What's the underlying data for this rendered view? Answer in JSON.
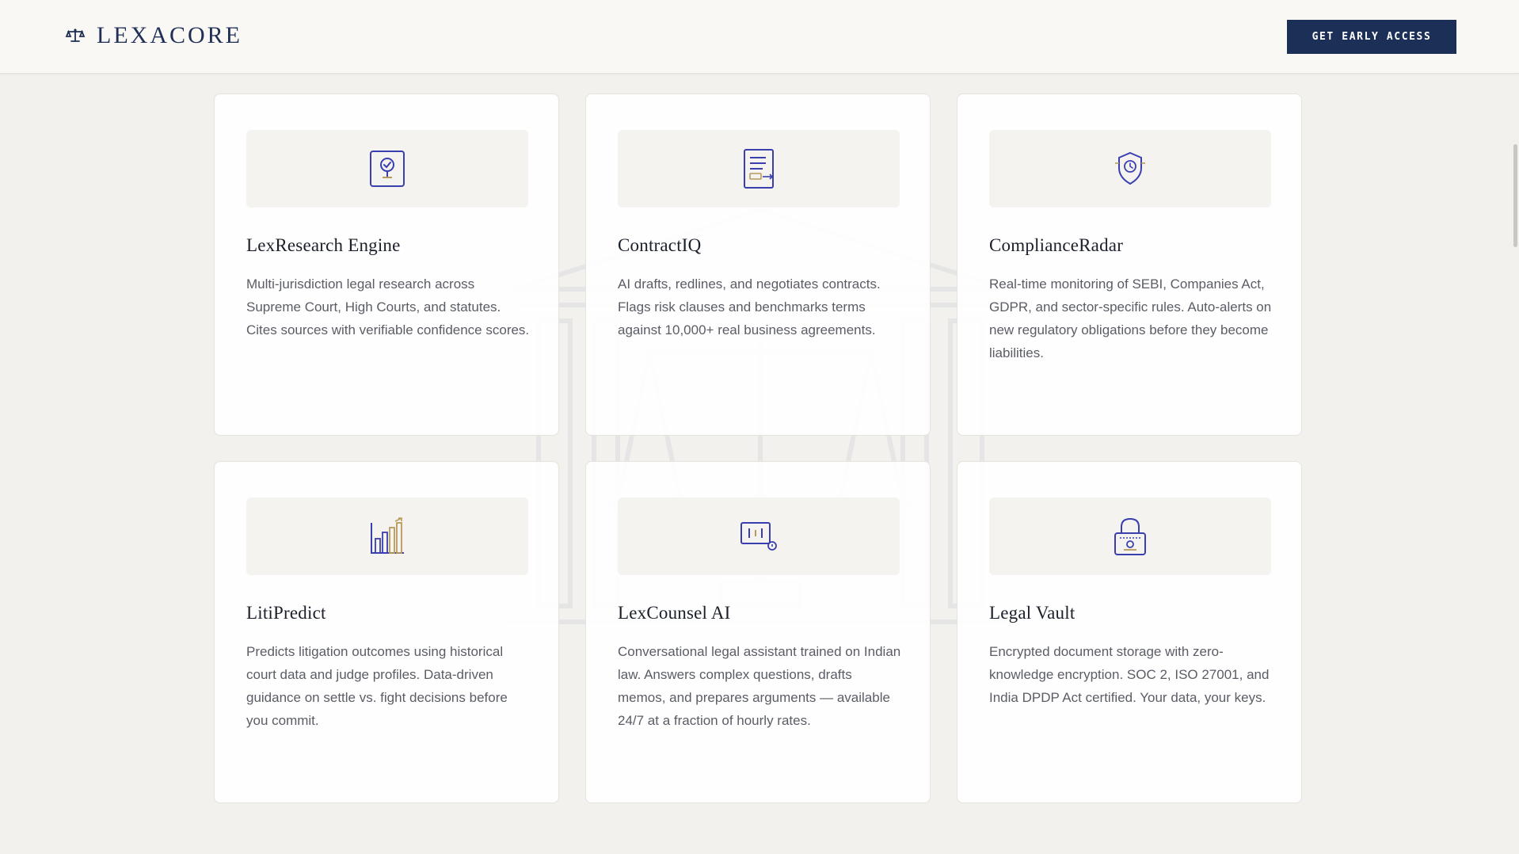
{
  "header": {
    "brand_name": "LEXACORE",
    "cta_label": "GET EARLY ACCESS"
  },
  "colors": {
    "brand_navy": "#1b2f57",
    "icon_blue": "#3a3fb0",
    "icon_gold": "#b89a5a",
    "page_background": "#f2f1ee"
  },
  "features": [
    {
      "title": "LexResearch Engine",
      "description": "Multi-jurisdiction legal research across Supreme Court, High Courts, and statutes. Cites sources with verifiable confidence scores.",
      "icon": "research-icon"
    },
    {
      "title": "ContractIQ",
      "description": "AI drafts, redlines, and negotiates contracts. Flags risk clauses and benchmarks terms against 10,000+ real business agreements.",
      "icon": "contract-icon"
    },
    {
      "title": "ComplianceRadar",
      "description": "Real-time monitoring of SEBI, Companies Act, GDPR, and sector-specific rules. Auto-alerts on new regulatory obligations before they become liabilities.",
      "icon": "compliance-shield-icon"
    },
    {
      "title": "LitiPredict",
      "description": "Predicts litigation outcomes using historical court data and judge profiles. Data-driven guidance on settle vs. fight decisions before you commit.",
      "icon": "bar-chart-icon"
    },
    {
      "title": "LexCounsel AI",
      "description": "Conversational legal assistant trained on Indian law. Answers complex questions, drafts memos, and prepares arguments — available 24/7 at a fraction of hourly rates.",
      "icon": "chat-assistant-icon"
    },
    {
      "title": "Legal Vault",
      "description": "Encrypted document storage with zero-knowledge encryption. SOC 2, ISO 27001, and India DPDP Act certified. Your data, your keys.",
      "icon": "lock-vault-icon"
    }
  ]
}
